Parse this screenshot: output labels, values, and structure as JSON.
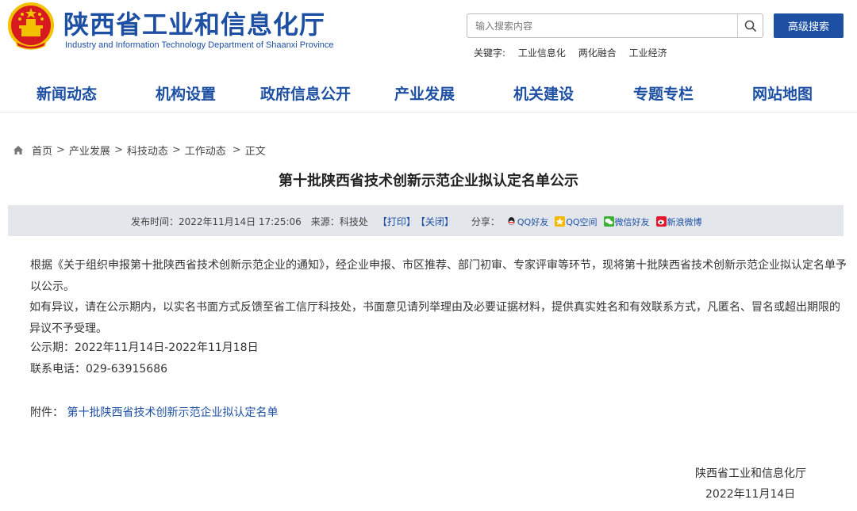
{
  "header": {
    "site_title": "陕西省工业和信息化厅",
    "site_subtitle": "Industry and Information Technology Department of Shaanxi Province",
    "search_placeholder": "输入搜索内容",
    "advanced_search_label": "高级搜索",
    "keywords_label": "关键字:",
    "keywords": [
      "工业信息化",
      "两化融合",
      "工业经济"
    ],
    "brand_color": "#1d4fa3"
  },
  "nav": {
    "items": [
      "新闻动态",
      "机构设置",
      "政府信息公开",
      "产业发展",
      "机关建设",
      "专题专栏",
      "网站地图"
    ]
  },
  "breadcrumb": {
    "home_icon": "home-icon",
    "items": [
      "首页",
      "产业发展",
      "科技动态",
      "工作动态",
      "正文"
    ],
    "separator": ">"
  },
  "article": {
    "title": "第十批陕西省技术创新示范企业拟认定名单公示",
    "publish_label": "发布时间：2022年11月14日 17:25:06",
    "source_label": "来源：",
    "source": "科技处",
    "print_label": "【打印】",
    "close_label": "【关闭】",
    "share_label": "分享：",
    "share": {
      "qq_friend": "QQ好友",
      "qzone": "QQ空间",
      "wechat": "微信好友",
      "weibo": "新浪微博"
    },
    "paragraph1": "根据《关于组织申报第十批陕西省技术创新示范企业的通知》，经企业申报、市区推荐、部门初审、专家评审等环节，现将第十批陕西省技术创新示范企业拟认定名单予以公示。",
    "paragraph2": "如有异议，请在公示期内，以实名书面方式反馈至省工信厅科技处，书面意见请列举理由及必要证据材料，提供真实姓名和有效联系方式，凡匿名、冒名或超出期限的异议不予受理。",
    "period": "公示期：2022年11月14日-2022年11月18日",
    "phone": "联系电话：029-63915686",
    "attachment_label": "附件：",
    "attachment_link": "第十批陕西省技术创新示范企业拟认定名单",
    "sign_org": "陕西省工业和信息化厅",
    "sign_date": "2022年11月14日"
  }
}
